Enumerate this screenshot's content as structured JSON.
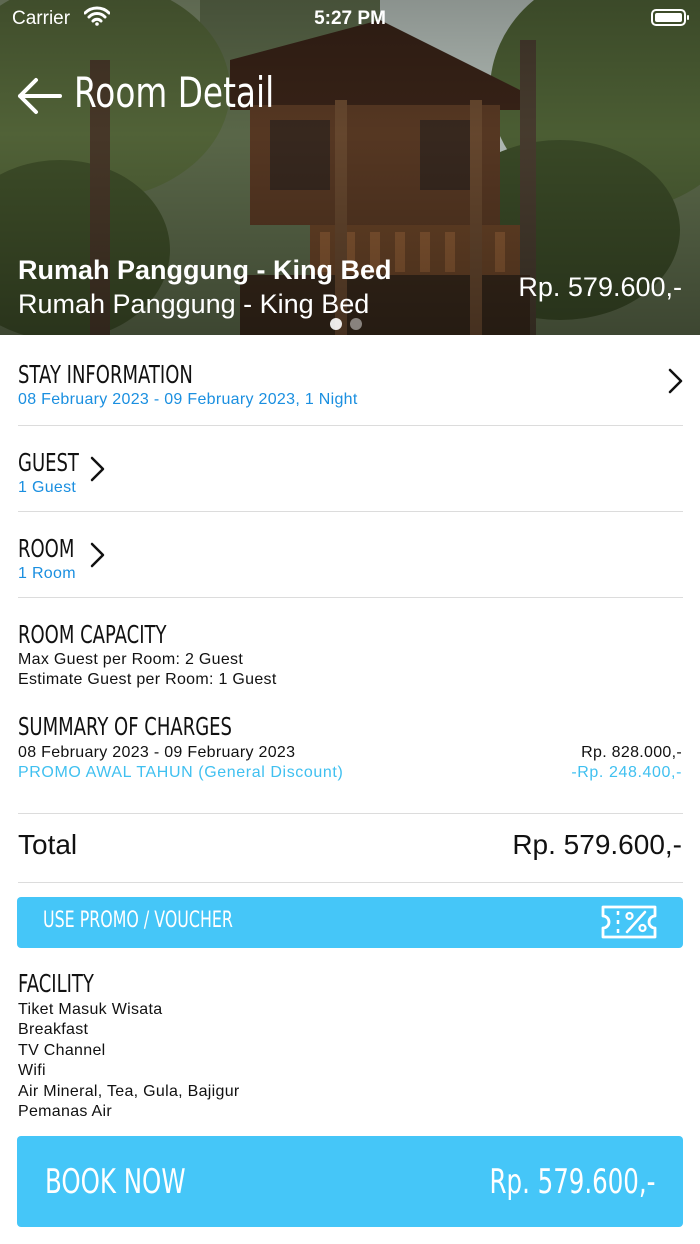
{
  "status_bar": {
    "carrier": "Carrier",
    "time": "5:27 PM"
  },
  "header": {
    "title": "Room Detail",
    "room_name_bold": "Rumah Panggung - King Bed",
    "room_name": "Rumah Panggung - King Bed",
    "price": "Rp. 579.600,-",
    "photo_page": {
      "current": 1,
      "total": 2
    }
  },
  "stay_info": {
    "title": "STAY INFORMATION",
    "value": "08 February 2023 - 09 February 2023, 1 Night"
  },
  "guest": {
    "title": "GUEST",
    "value": "1 Guest"
  },
  "room": {
    "title": "ROOM",
    "value": "1 Room"
  },
  "room_capacity": {
    "title": "ROOM CAPACITY",
    "max_guest": "Max Guest per Room: 2 Guest",
    "estimate_guest": "Estimate Guest per Room: 1 Guest"
  },
  "summary": {
    "title": "SUMMARY OF CHARGES",
    "date_range": "08 February 2023 - 09 February 2023",
    "date_amount": "Rp. 828.000,-",
    "promo_name": "PROMO AWAL TAHUN (General Discount)",
    "promo_amount": "-Rp. 248.400,-"
  },
  "total": {
    "label": "Total",
    "value": "Rp. 579.600,-"
  },
  "promo_button": {
    "label": "USE PROMO / VOUCHER",
    "icon": "voucher-icon"
  },
  "facility": {
    "title": "FACILITY",
    "items": [
      "Tiket Masuk Wisata",
      "Breakfast",
      "TV Channel",
      "Wifi",
      "Air Mineral, Tea, Gula, Bajigur",
      "Pemanas Air"
    ]
  },
  "book_button": {
    "label": "BOOK NOW",
    "price": "Rp. 579.600,-"
  },
  "colors": {
    "accent_blue": "#45c6f8",
    "link_blue": "#1a8fe0",
    "promo_blue": "#40c0f0"
  }
}
